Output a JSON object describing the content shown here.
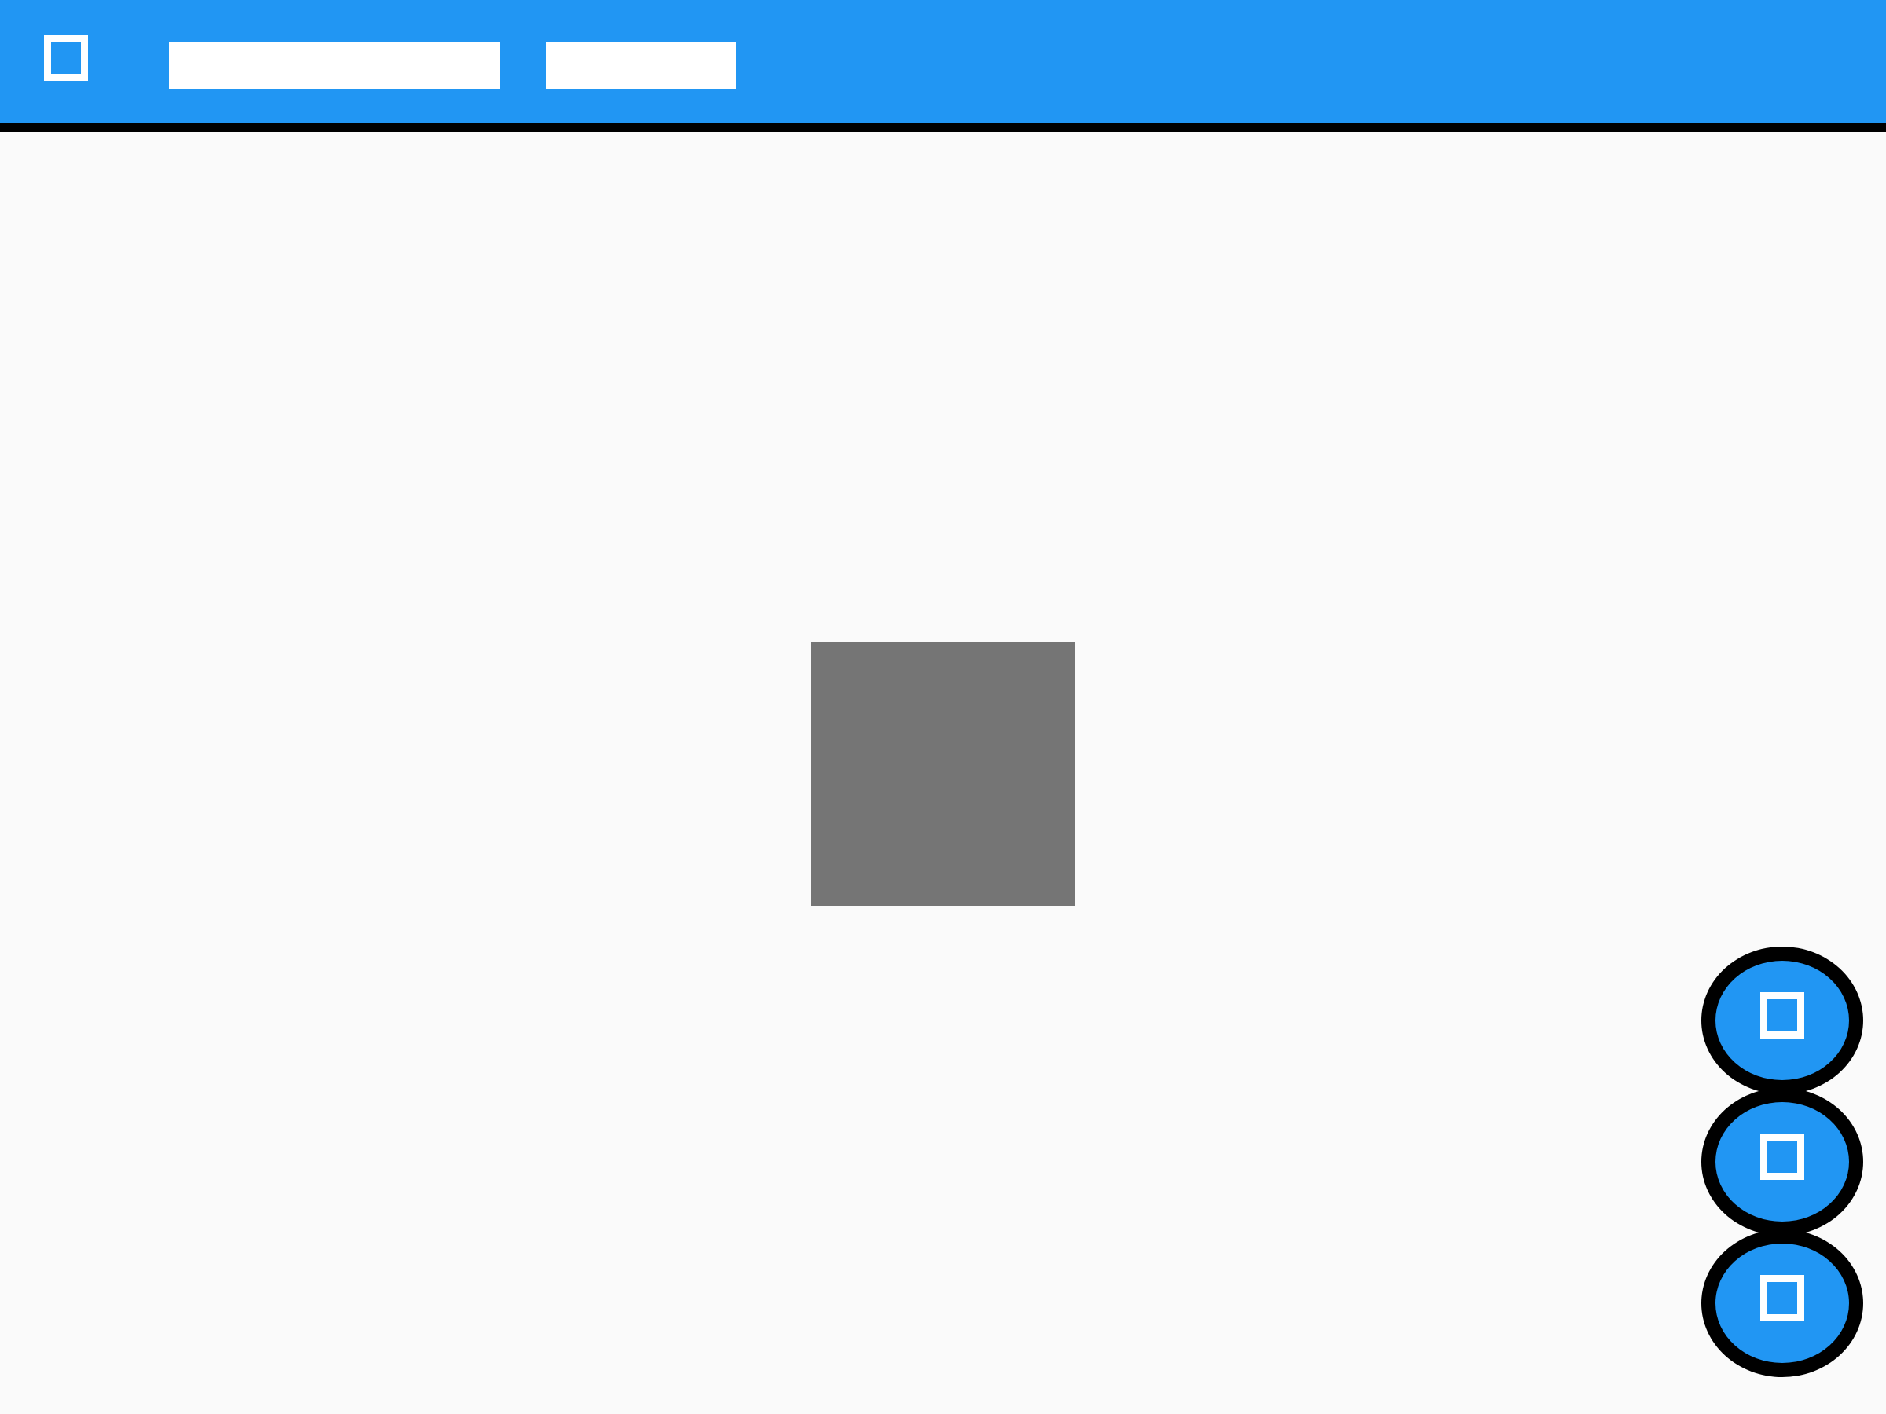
{
  "app_bar": {
    "background_color": "#2196f3",
    "divider_color": "#000000",
    "menu_icon": "square-outline-icon",
    "title_primary": "",
    "title_secondary": ""
  },
  "content": {
    "background_color": "#fafafa",
    "placeholder_color": "#757575"
  },
  "fabs": [
    {
      "icon": "square-outline-icon"
    },
    {
      "icon": "square-outline-icon"
    },
    {
      "icon": "square-outline-icon"
    }
  ]
}
